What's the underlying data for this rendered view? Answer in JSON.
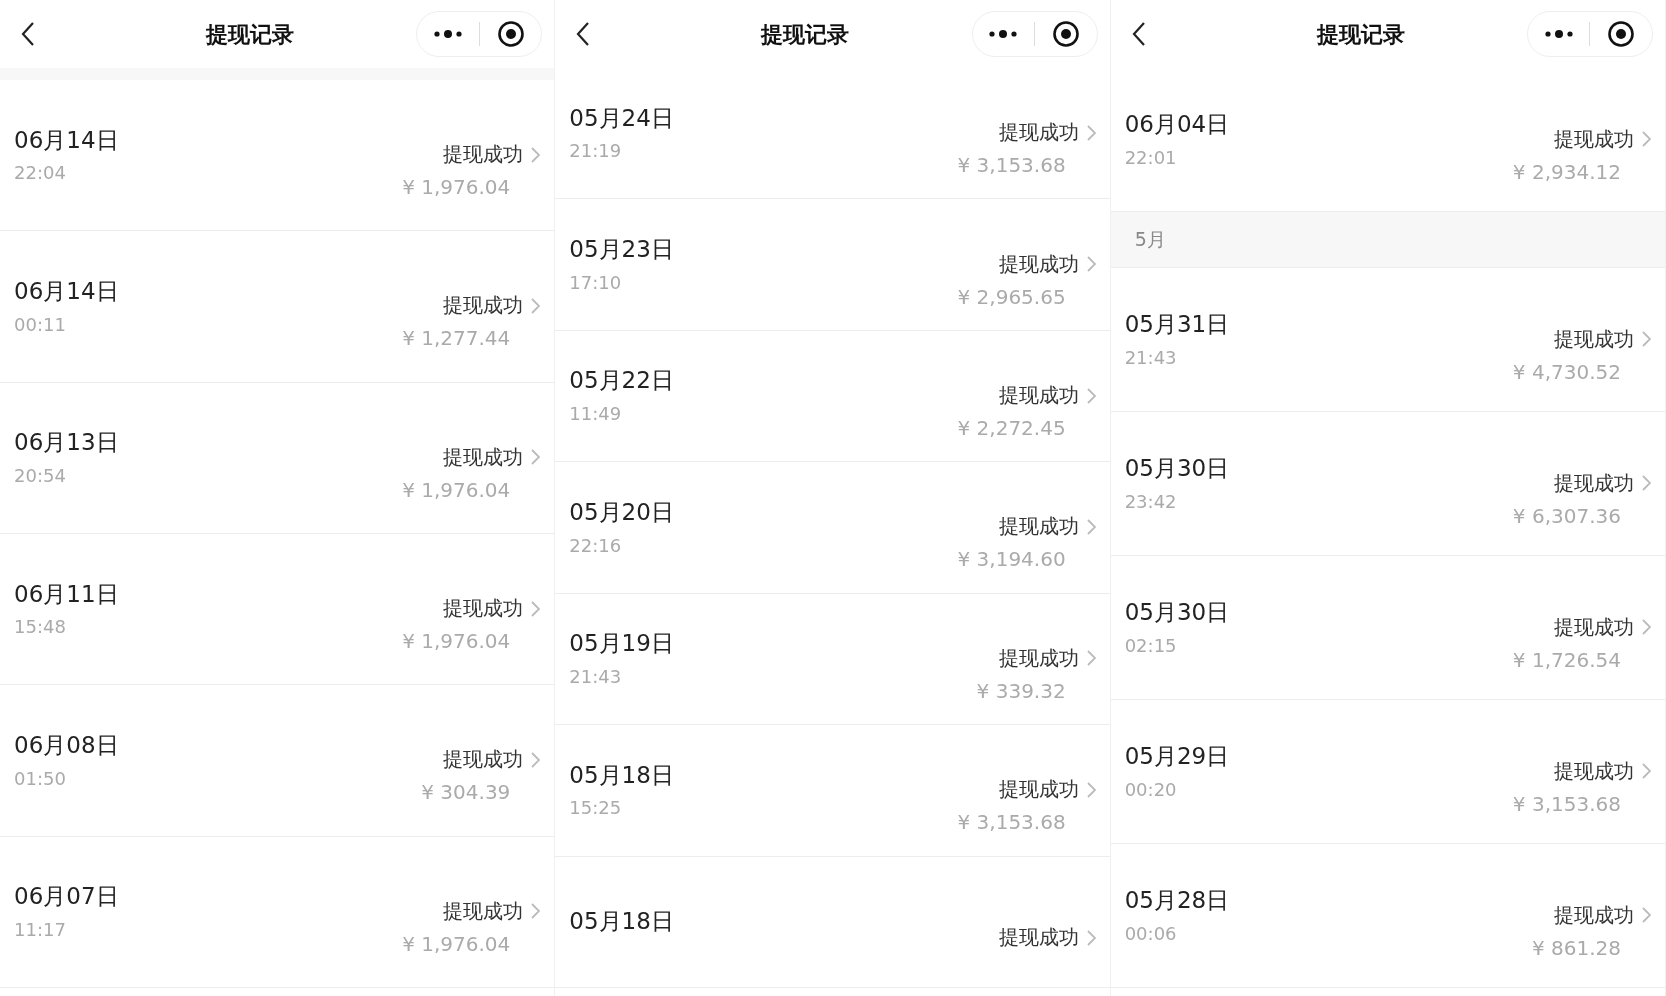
{
  "panels": [
    {
      "title": "提现记录",
      "top_gap": true,
      "items": [
        {
          "kind": "record",
          "date": "06月14日",
          "time": "22:04",
          "status": "提现成功",
          "amount": "¥ 1,976.04"
        },
        {
          "kind": "record",
          "date": "06月14日",
          "time": "00:11",
          "status": "提现成功",
          "amount": "¥ 1,277.44"
        },
        {
          "kind": "record",
          "date": "06月13日",
          "time": "20:54",
          "status": "提现成功",
          "amount": "¥ 1,976.04"
        },
        {
          "kind": "record",
          "date": "06月11日",
          "time": "15:48",
          "status": "提现成功",
          "amount": "¥ 1,976.04"
        },
        {
          "kind": "record",
          "date": "06月08日",
          "time": "01:50",
          "status": "提现成功",
          "amount": "¥ 304.39"
        },
        {
          "kind": "record",
          "date": "06月07日",
          "time": "11:17",
          "status": "提现成功",
          "amount": "¥ 1,976.04"
        }
      ]
    },
    {
      "title": "提现记录",
      "top_gap": false,
      "items": [
        {
          "kind": "record",
          "date": "05月24日",
          "time": "21:19",
          "status": "提现成功",
          "amount": "¥ 3,153.68"
        },
        {
          "kind": "record",
          "date": "05月23日",
          "time": "17:10",
          "status": "提现成功",
          "amount": "¥ 2,965.65"
        },
        {
          "kind": "record",
          "date": "05月22日",
          "time": "11:49",
          "status": "提现成功",
          "amount": "¥ 2,272.45"
        },
        {
          "kind": "record",
          "date": "05月20日",
          "time": "22:16",
          "status": "提现成功",
          "amount": "¥ 3,194.60"
        },
        {
          "kind": "record",
          "date": "05月19日",
          "time": "21:43",
          "status": "提现成功",
          "amount": "¥ 339.32"
        },
        {
          "kind": "record",
          "date": "05月18日",
          "time": "15:25",
          "status": "提现成功",
          "amount": "¥ 3,153.68"
        },
        {
          "kind": "record",
          "date": "05月18日",
          "status": "提现成功"
        }
      ]
    },
    {
      "title": "提现记录",
      "top_gap": false,
      "items": [
        {
          "kind": "record",
          "date": "06月04日",
          "time": "22:01",
          "status": "提现成功",
          "amount": "¥ 2,934.12"
        },
        {
          "kind": "month",
          "label": "5月"
        },
        {
          "kind": "record",
          "date": "05月31日",
          "time": "21:43",
          "status": "提现成功",
          "amount": "¥ 4,730.52"
        },
        {
          "kind": "record",
          "date": "05月30日",
          "time": "23:42",
          "status": "提现成功",
          "amount": "¥ 6,307.36"
        },
        {
          "kind": "record",
          "date": "05月30日",
          "time": "02:15",
          "status": "提现成功",
          "amount": "¥ 1,726.54"
        },
        {
          "kind": "record",
          "date": "05月29日",
          "time": "00:20",
          "status": "提现成功",
          "amount": "¥ 3,153.68"
        },
        {
          "kind": "record",
          "date": "05月28日",
          "time": "00:06",
          "status": "提现成功",
          "amount": "¥ 861.28"
        }
      ]
    }
  ]
}
